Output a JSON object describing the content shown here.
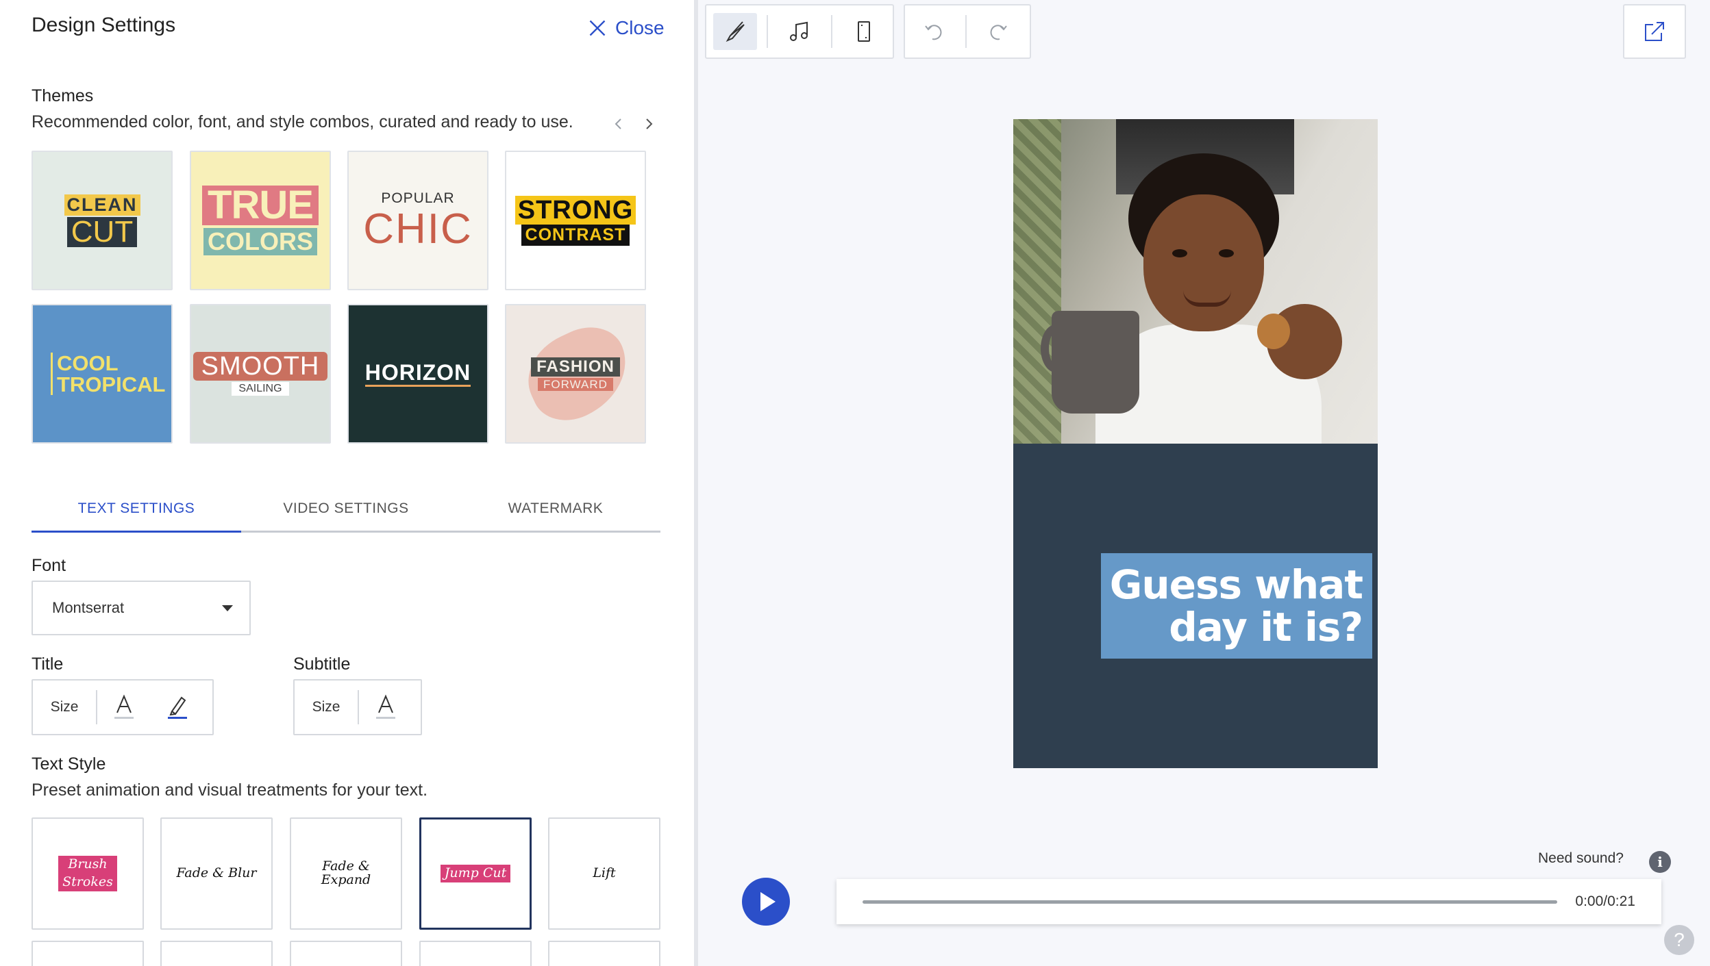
{
  "panel": {
    "title": "Design Settings",
    "close_label": "Close"
  },
  "themes": {
    "heading": "Themes",
    "description": "Recommended color, font, and style combos, curated and ready to use.",
    "items": [
      {
        "line1": "CLEAN",
        "line2": "CUT"
      },
      {
        "line1": "TRUE",
        "line2": "COLORS"
      },
      {
        "line1": "POPULAR",
        "line2": "CHIC"
      },
      {
        "line1": "STRONG",
        "line2": "CONTRAST"
      },
      {
        "line1": "COOL",
        "line2": "TROPICAL"
      },
      {
        "line1": "SMOOTH",
        "line2": "SAILING"
      },
      {
        "line1": "HORIZON"
      },
      {
        "line1": "FASHION",
        "line2": "FORWARD"
      }
    ]
  },
  "tabs": [
    {
      "label": "TEXT SETTINGS",
      "active": true
    },
    {
      "label": "VIDEO SETTINGS",
      "active": false
    },
    {
      "label": "WATERMARK",
      "active": false
    }
  ],
  "font": {
    "label": "Font",
    "selected": "Montserrat"
  },
  "title_controls": {
    "label": "Title",
    "size_label": "Size"
  },
  "subtitle_controls": {
    "label": "Subtitle",
    "size_label": "Size"
  },
  "text_style": {
    "heading": "Text Style",
    "description": "Preset animation and visual treatments for your text.",
    "items": [
      {
        "line1": "Brush",
        "line2": "Strokes"
      },
      {
        "line1": "Fade & Blur"
      },
      {
        "line1": "Fade &",
        "line2": "Expand"
      },
      {
        "line1": "Jump Cut",
        "selected": true
      },
      {
        "line1": "Lift"
      }
    ]
  },
  "preview": {
    "caption_line1": "Guess what",
    "caption_line2": "day it is?"
  },
  "player": {
    "need_sound": "Need sound?",
    "time": "0:00/0:21",
    "progress": 0
  },
  "colors": {
    "accent": "#2b4fc9",
    "preview_bg": "#2f3f4f",
    "caption_bg": "#6699c8"
  }
}
